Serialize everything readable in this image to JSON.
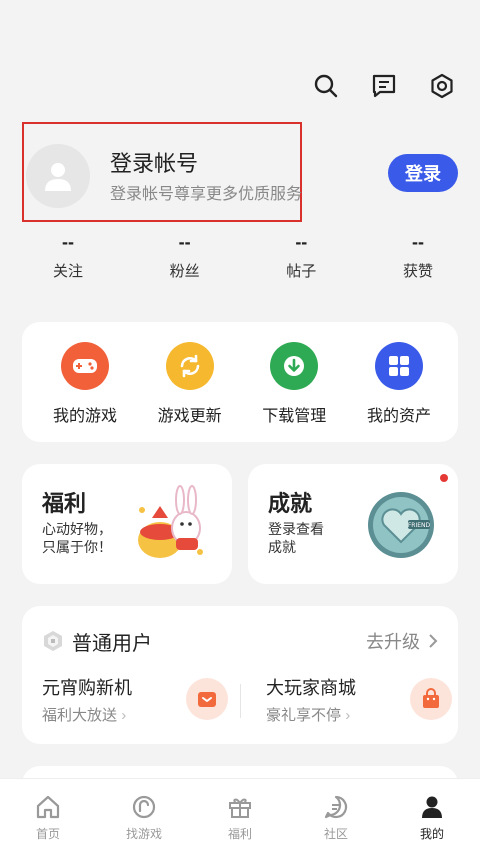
{
  "topbar": {
    "icons": [
      "search-icon",
      "message-icon",
      "settings-icon"
    ]
  },
  "profile": {
    "name": "登录帐号",
    "subtitle": "登录帐号尊享更多优质服务",
    "login_label": "登录"
  },
  "stats": [
    {
      "value": "--",
      "label": "关注"
    },
    {
      "value": "--",
      "label": "粉丝"
    },
    {
      "value": "--",
      "label": "帖子"
    },
    {
      "value": "--",
      "label": "获赞"
    }
  ],
  "tools": [
    {
      "label": "我的游戏",
      "icon": "gamepad-icon",
      "color": "#f2603a"
    },
    {
      "label": "游戏更新",
      "icon": "refresh-icon",
      "color": "#f5b82e"
    },
    {
      "label": "下载管理",
      "icon": "download-icon",
      "color": "#2faa54"
    },
    {
      "label": "我的资产",
      "icon": "grid-icon",
      "color": "#3a5bea"
    }
  ],
  "cards": {
    "fuli": {
      "title": "福利",
      "desc": "心动好物，\n只属于你！"
    },
    "chengjiu": {
      "title": "成就",
      "desc": "登录查看\n成就",
      "badge_text": "FRIEND"
    }
  },
  "member": {
    "level": "普通用户",
    "upgrade": "去升级",
    "promos": [
      {
        "title": "元宵购新机",
        "sub": "福利大放送"
      },
      {
        "title": "大玩家商城",
        "sub": "豪礼享不停"
      }
    ]
  },
  "bottom_nav": [
    {
      "label": "首页",
      "icon": "home-icon"
    },
    {
      "label": "找游戏",
      "icon": "find-game-icon"
    },
    {
      "label": "福利",
      "icon": "gift-icon"
    },
    {
      "label": "社区",
      "icon": "community-icon"
    },
    {
      "label": "我的",
      "icon": "profile-icon",
      "active": true
    }
  ],
  "colors": {
    "accent": "#3a5bea",
    "highlight_border": "#d9302c"
  }
}
